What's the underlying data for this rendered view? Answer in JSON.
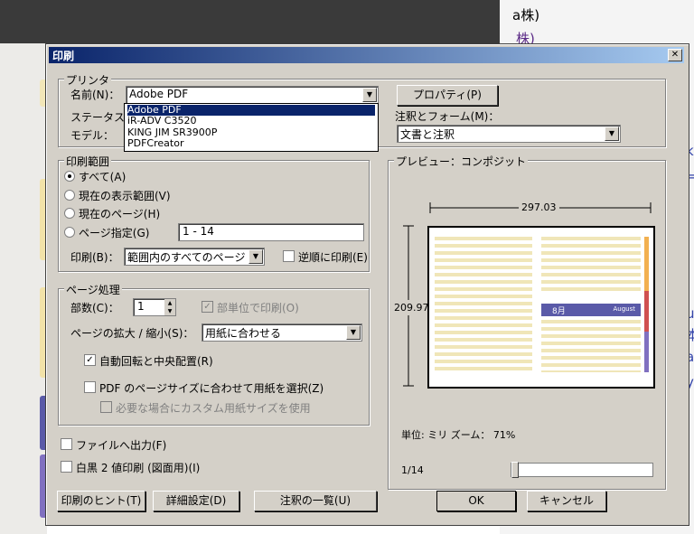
{
  "background": {
    "right_texts": [
      "a株)",
      "株)",
      "k",
      "=",
      "u",
      "本",
      "a",
      "y"
    ]
  },
  "dialog": {
    "title": "印刷",
    "close_glyph": "✕",
    "printer": {
      "group_label": "プリンタ",
      "name_label": "名前(N)：",
      "name_value": "Adobe PDF",
      "status_label": "ステータス：",
      "model_label": "モデル：",
      "properties_button": "プロパティ(P)",
      "annotations_label": "注釈とフォーム(M)：",
      "annotations_value": "文書と注釈",
      "dropdown_options": [
        "Adobe PDF",
        "iR-ADV C3520",
        "KING JIM SR3900P",
        "PDFCreator"
      ]
    },
    "range": {
      "group_label": "印刷範囲",
      "all": "すべて(A)",
      "current_view": "現在の表示範囲(V)",
      "current_page": "現在のページ(H)",
      "pages": "ページ指定(G)",
      "pages_value": "1 - 14",
      "print_label": "印刷(B)：",
      "print_value": "範囲内のすべてのページ",
      "reverse": "逆順に印刷(E)"
    },
    "page_handling": {
      "group_label": "ページ処理",
      "copies_label": "部数(C)：",
      "copies_value": "1",
      "collate": "部単位で印刷(O)",
      "scaling_label": "ページの拡大 / 縮小(S)：",
      "scaling_value": "用紙に合わせる",
      "auto_rotate": "自動回転と中央配置(R)",
      "choose_paper": "PDF のページサイズに合わせて用紙を選択(Z)",
      "custom_paper": "必要な場合にカスタム用紙サイズを使用"
    },
    "print_to_file": "ファイルへ出力(F)",
    "bw_print": "白黒 2 値印刷 (図面用)(I)",
    "preview": {
      "group_label": "プレビュー：コンポジット",
      "width_dim": "297.03",
      "height_dim": "209.97",
      "units": "単位: ミリ  ズーム： 71%",
      "page_counter": "1/14",
      "month_label": "8月",
      "month_en": "August"
    },
    "buttons": {
      "hints": "印刷のヒント(T)",
      "advanced": "詳細設定(D)",
      "summarize": "注釈の一覧(U)",
      "ok": "OK",
      "cancel": "キャンセル"
    }
  }
}
